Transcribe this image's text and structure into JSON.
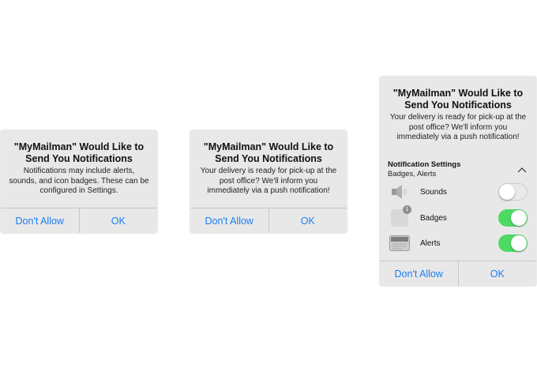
{
  "alerts": [
    {
      "title": "\"MyMailman\" Would Like to Send You Notifications",
      "message": "Notifications may include alerts, sounds, and icon badges. These can be configured in Settings.",
      "buttons": {
        "deny": "Don't Allow",
        "ok": "OK"
      }
    },
    {
      "title": "\"MyMailman\" Would Like to Send You Notifications",
      "message": "Your delivery is ready for pick-up at the post office? We'll inform you immediately via a push notification!",
      "buttons": {
        "deny": "Don't Allow",
        "ok": "OK"
      }
    },
    {
      "title": "\"MyMailman\" Would Like to Send You Notifications",
      "message": "Your delivery is ready for pick-up at the post office? We'll inform you immediately via a push notification!",
      "settings": {
        "title": "Notification Settings",
        "summary": "Badges, Alerts",
        "expand_icon": "chevron-up-icon",
        "rows": [
          {
            "label": "Sounds",
            "icon": "speaker-icon",
            "enabled": false
          },
          {
            "label": "Badges",
            "icon": "badge-icon",
            "badge_count": "1",
            "enabled": true
          },
          {
            "label": "Alerts",
            "icon": "banner-alert-icon",
            "enabled": true
          }
        ]
      },
      "buttons": {
        "deny": "Don't Allow",
        "ok": "OK"
      }
    }
  ],
  "colors": {
    "accent": "#1a7ef2",
    "toggle_on": "#4cd964",
    "alert_bg": "#e8e8e8"
  }
}
